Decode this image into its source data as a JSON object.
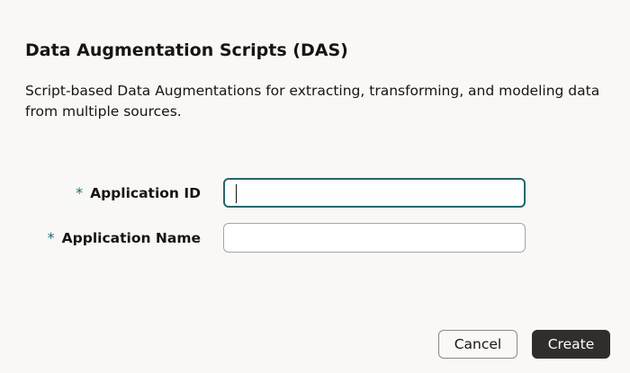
{
  "dialog": {
    "title": "Data Augmentation Scripts (DAS)",
    "description": "Script-based Data Augmentations for extracting, transforming, and modeling data from multiple sources."
  },
  "form": {
    "required_marker": "*",
    "application_id": {
      "label": "Application ID",
      "value": "",
      "focused": true
    },
    "application_name": {
      "label": "Application Name",
      "value": ""
    }
  },
  "actions": {
    "cancel_label": "Cancel",
    "create_label": "Create"
  },
  "colors": {
    "background": "#f9f8f6",
    "required_marker": "#1a6a70",
    "focus_border": "#24676c",
    "primary_button": "#312d2a"
  }
}
